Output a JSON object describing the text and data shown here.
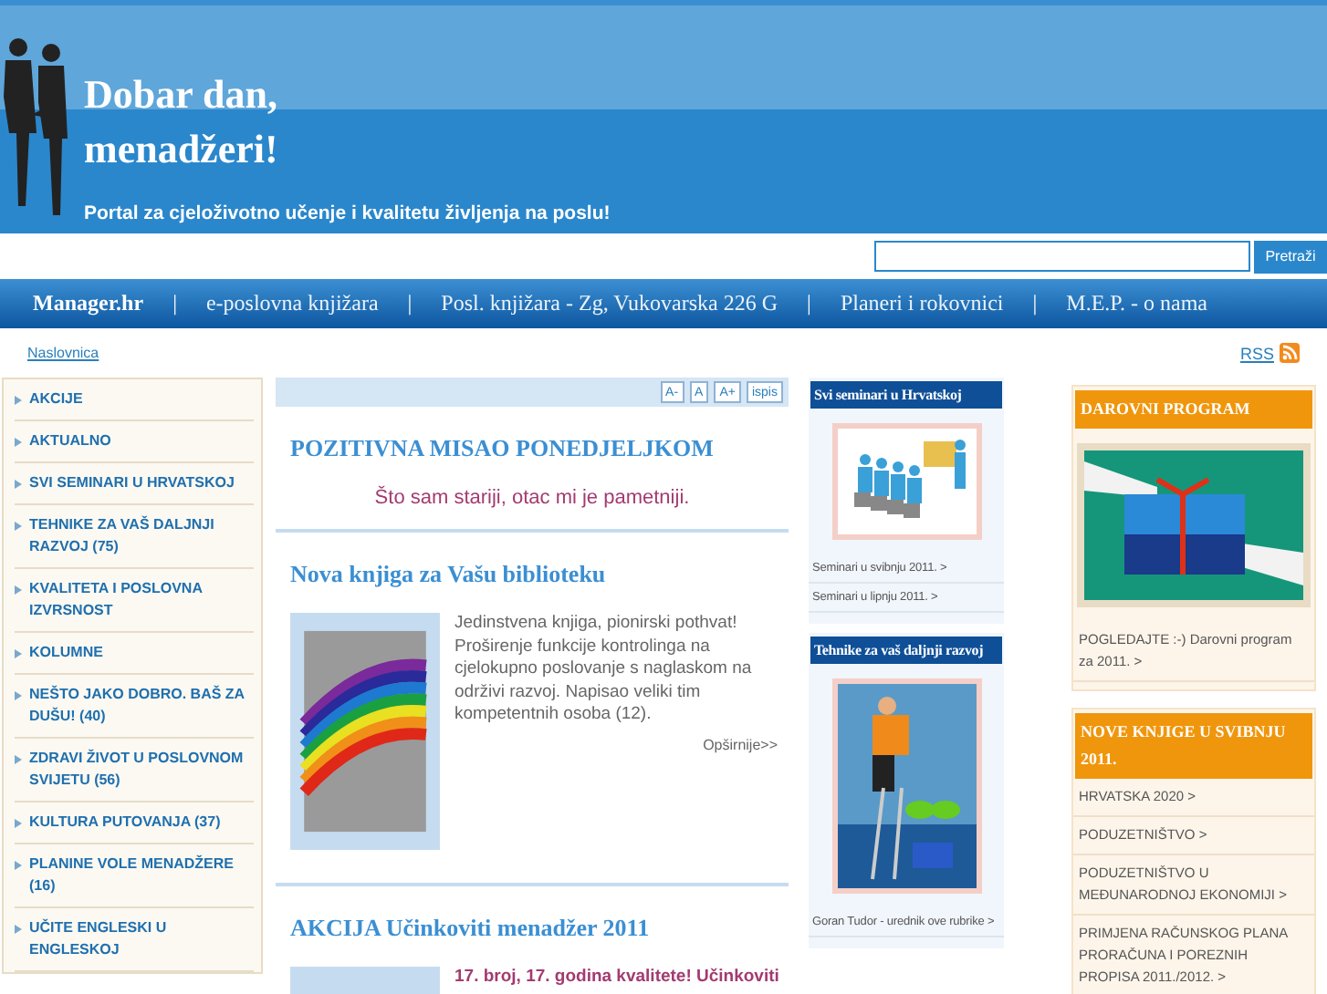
{
  "header": {
    "title_line_1": "Dobar dan,",
    "title_line_2": "menadžeri!",
    "tagline": "Portal za cjeloživotno učenje i kvalitetu življenja na poslu!"
  },
  "search": {
    "button": "Pretraži"
  },
  "nav": [
    {
      "label": "Manager.hr",
      "selected": true
    },
    {
      "label": "e-poslovna knjižara",
      "selected": false
    },
    {
      "label": "Posl. knjižara - Zg, Vukovarska 226 G",
      "selected": false
    },
    {
      "label": "Planeri i rokovnici",
      "selected": false
    },
    {
      "label": "M.E.P. - o nama",
      "selected": false
    }
  ],
  "nav_separator": "|",
  "breadcrumb": "Naslovnica",
  "rss": "RSS",
  "sidebar": {
    "items": [
      "AKCIJE",
      "AKTUALNO",
      "SVI SEMINARI U HRVATSKOJ",
      "TEHNIKE ZA VAŠ DALJNJI RAZVOJ (75)",
      "KVALITETA I POSLOVNA IZVRSNOST",
      "KOLUMNE",
      "NEŠTO JAKO DOBRO. BAŠ ZA DUŠU! (40)",
      "ZDRAVI ŽIVOT U POSLOVNOM SVIJETU (56)",
      "KULTURA PUTOVANJA (37)",
      "PLANINE VOLE MENADŽERE (16)",
      "UČITE ENGLESKI U ENGLESKOJ"
    ]
  },
  "toolbar": [
    "A-",
    "A",
    "A+",
    "ispis"
  ],
  "quote": {
    "title": "POZITIVNA MISAO PONEDJELJKOM",
    "text": "Što sam stariji, otac mi je pametniji."
  },
  "articles": [
    {
      "title": "Nova knjiga za Vašu biblioteku",
      "text": "Jedinstvena knjiga, pionirski pothvat! Proširenje funkcije kontrolinga na cjelokupno poslovanje s naglaskom na održivi razvoj. Napisao veliki tim kompetentnih osoba (12).",
      "more": "Opširnije>>"
    },
    {
      "title": "AKCIJA Učinkoviti menadžer 2011",
      "lead": "17. broj, 17. godina kvalitete! Učinkoviti"
    }
  ],
  "seminars": {
    "title": "Svi seminari u Hrvatskoj",
    "links": [
      "Seminari u svibnju 2011. >",
      "Seminari u lipnju 2011. >"
    ]
  },
  "techniques": {
    "title": "Tehnike za vaš daljnji razvoj",
    "links": [
      "Goran Tudor - urednik ove rubrike >"
    ]
  },
  "gift": {
    "title": "DAROVNI PROGRAM",
    "text": "POGLEDAJTE :-) Darovni program za 2011. >"
  },
  "books": {
    "title": "NOVE KNJIGE U SVIBNJU 2011.",
    "links": [
      "HRVATSKA 2020 >",
      "PODUZETNIŠTVO >",
      "PODUZETNIŠTVO U MEĐUNARODNOJ EKONOMIJI >",
      "PRIMJENA RAČUNSKOG PLANA PRORAČUNA I POREZNIH PROPISA 2011./2012. >"
    ]
  }
}
